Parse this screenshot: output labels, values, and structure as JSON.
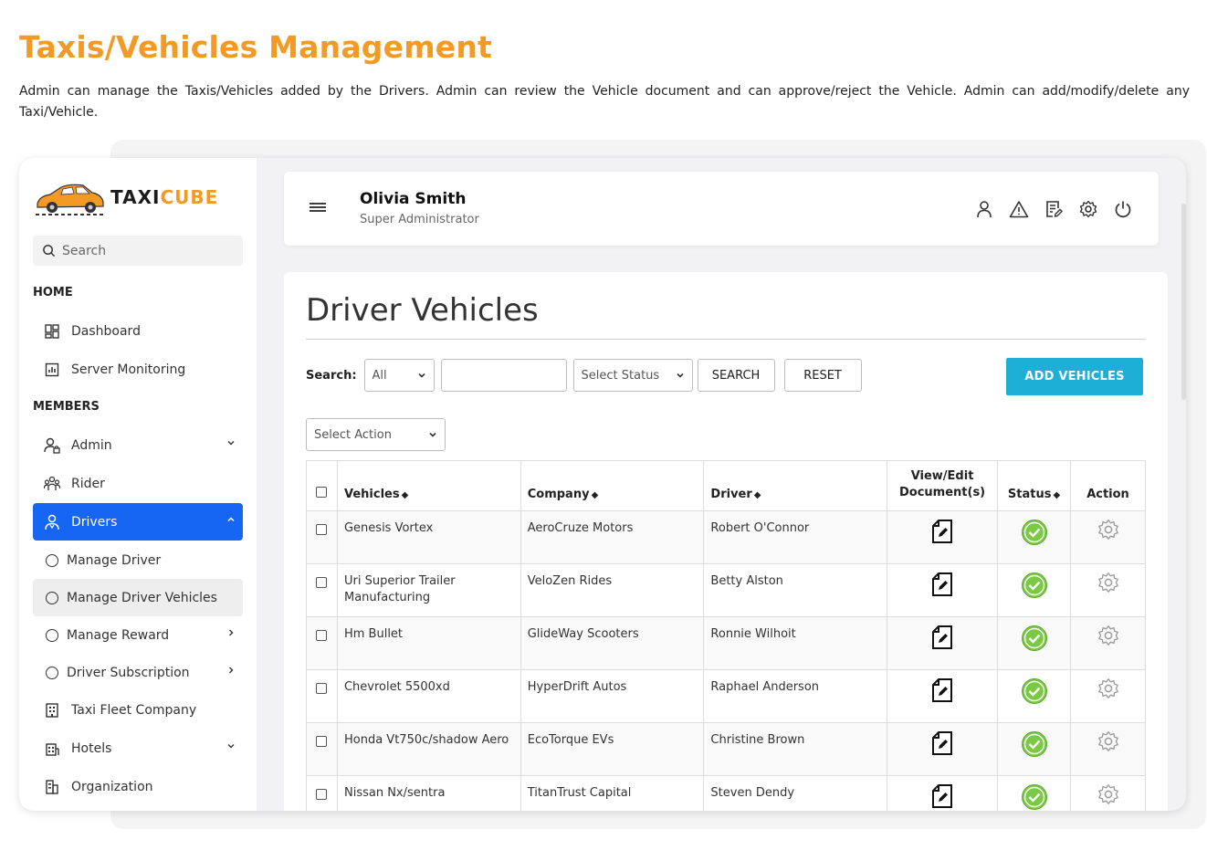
{
  "page": {
    "heading": "Taxis/Vehicles Management",
    "intro": "Admin can manage the Taxis/Vehicles added by the Drivers. Admin can review the Vehicle document and can approve/reject the Vehicle. Admin can add/modify/delete any Taxi/Vehicle."
  },
  "logo": {
    "taxi": "TAXI",
    "cube": "CUBE"
  },
  "sidebar": {
    "search_placeholder": "Search",
    "home_label": "HOME",
    "members_label": "MEMBERS",
    "items": {
      "dashboard": "Dashboard",
      "server_monitoring": "Server Monitoring",
      "admin": "Admin",
      "rider": "Rider",
      "drivers": "Drivers",
      "manage_driver": "Manage Driver",
      "manage_driver_vehicles": "Manage Driver Vehicles",
      "manage_reward": "Manage Reward",
      "driver_subscription": "Driver Subscription",
      "taxi_fleet_company": "Taxi Fleet Company",
      "hotels": "Hotels",
      "organization": "Organization"
    }
  },
  "topbar": {
    "user_name": "Olivia Smith",
    "user_role": "Super Administrator"
  },
  "content": {
    "title": "Driver Vehicles",
    "search_label": "Search:",
    "filter_all": "All",
    "status_placeholder": "Select Status",
    "search_button": "SEARCH",
    "reset_button": "RESET",
    "add_button": "ADD VEHICLES",
    "action_placeholder": "Select Action"
  },
  "table": {
    "headers": {
      "vehicles": "Vehicles",
      "company": "Company",
      "driver": "Driver",
      "view_edit_1": "View/Edit",
      "view_edit_2": "Document(s)",
      "status": "Status",
      "action": "Action"
    },
    "rows": [
      {
        "vehicle": "Genesis Vortex",
        "company": "AeroCruze Motors",
        "driver": "Robert O'Connor"
      },
      {
        "vehicle": "Uri Superior Trailer Manufacturing",
        "company": "VeloZen Rides",
        "driver": "Betty Alston"
      },
      {
        "vehicle": "Hm Bullet",
        "company": "GlideWay Scooters",
        "driver": "Ronnie Wilhoit"
      },
      {
        "vehicle": "Chevrolet 5500xd",
        "company": "HyperDrift Autos",
        "driver": "Raphael Anderson"
      },
      {
        "vehicle": "Honda Vt750c/shadow Aero",
        "company": "EcoTorque EVs",
        "driver": "Christine Brown"
      },
      {
        "vehicle": "Nissan Nx/sentra",
        "company": "TitanTrust Capital",
        "driver": "Steven Dendy"
      }
    ]
  },
  "colors": {
    "accent": "#f29a24",
    "primary": "#1665f3",
    "add_button": "#1eafd7",
    "status_green": "#7ac943"
  },
  "icons": [
    "search-icon",
    "dashboard-icon",
    "monitor-icon",
    "admin-icon",
    "rider-icon",
    "driver-icon",
    "building-icon",
    "hotel-icon",
    "organization-icon",
    "hamburger-icon",
    "user-icon",
    "warning-icon",
    "edit-note-icon",
    "gear-icon",
    "power-icon",
    "document-edit-icon",
    "check-circle-icon"
  ]
}
